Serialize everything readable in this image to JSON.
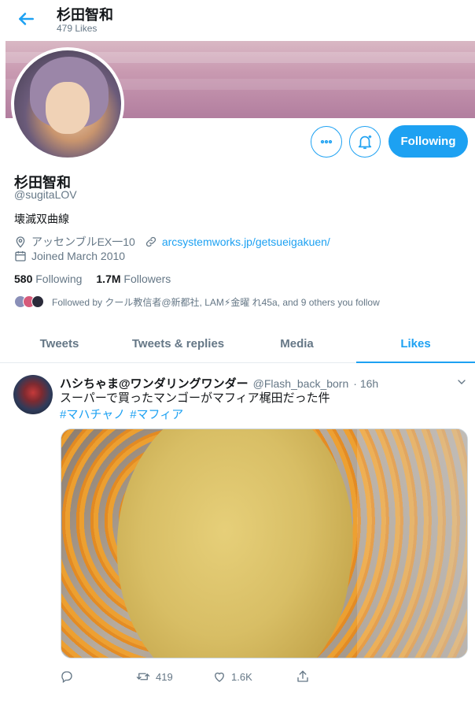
{
  "header": {
    "name": "杉田智和",
    "likes_count": "479 Likes"
  },
  "profile": {
    "name": "杉田智和",
    "handle": "@sugitaLOV",
    "bio": "壊滅双曲線",
    "location": "アッセンブルEX一10",
    "website": "arcsystemworks.jp/getsueigakuen/",
    "joined": "Joined March 2010",
    "following_count": "580",
    "following_label": "Following",
    "followers_count": "1.7M",
    "followers_label": "Followers",
    "followed_by": "Followed by クール教信者@新都社, LAM⚡金曜 れ45a, and 9 others you follow",
    "follow_button": "Following"
  },
  "tabs": [
    {
      "label": "Tweets"
    },
    {
      "label": "Tweets & replies"
    },
    {
      "label": "Media"
    },
    {
      "label": "Likes"
    }
  ],
  "tweet": {
    "name": "ハシちゃま@ワンダリングワンダー",
    "handle": "@Flash_back_born",
    "time": "· 16h",
    "text": "スーパーで買ったマンゴーがマフィア梶田だった件",
    "hashtags": [
      "#マハチャノ",
      "#マフィア"
    ],
    "retweets": "419",
    "likes": "1.6K"
  },
  "colors": {
    "accent": "#1da1f2",
    "muted": "#657786",
    "text": "#14171a"
  },
  "icons": [
    "back-arrow-icon",
    "more-icon",
    "notification-bell-icon",
    "location-icon",
    "link-icon",
    "calendar-icon",
    "chevron-down-icon",
    "reply-icon",
    "retweet-icon",
    "like-icon",
    "share-icon"
  ]
}
